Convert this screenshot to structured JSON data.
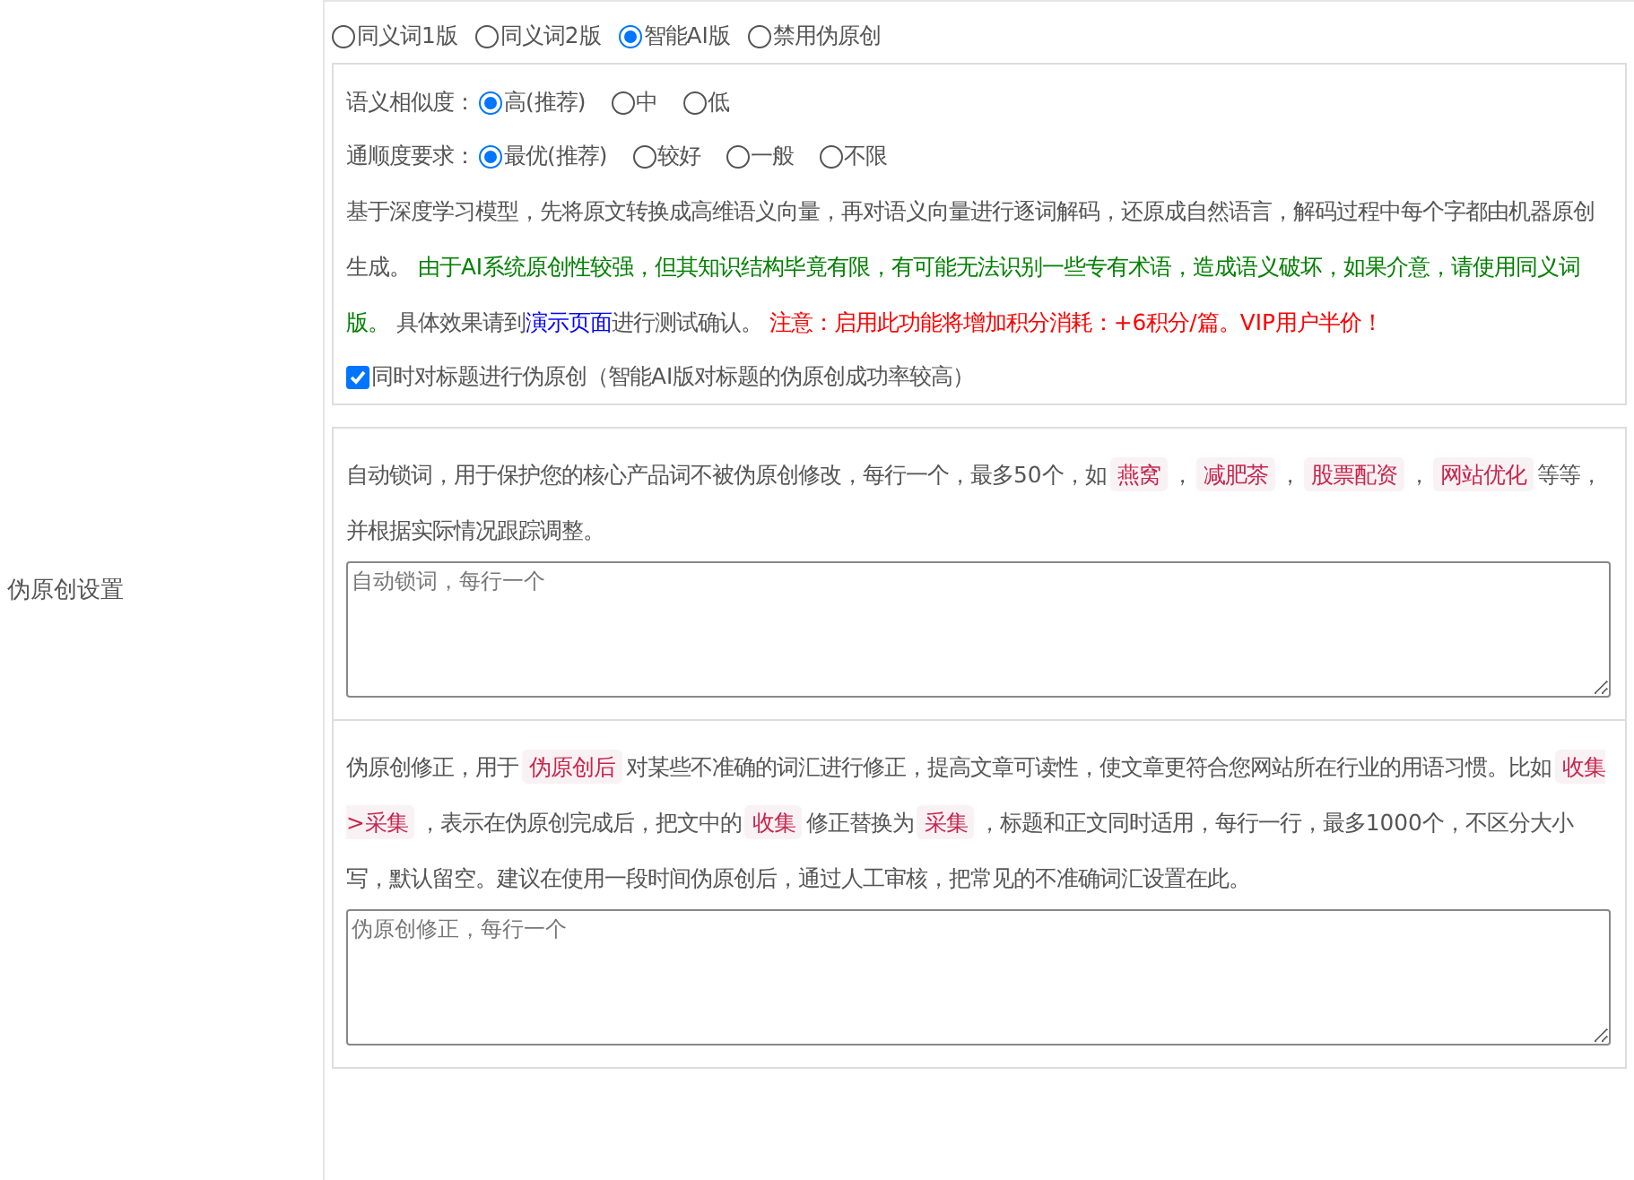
{
  "sidebar": {
    "label": "伪原创设置"
  },
  "modes": [
    {
      "label": "同义词1版",
      "selected": false
    },
    {
      "label": "同义词2版",
      "selected": false
    },
    {
      "label": "智能AI版",
      "selected": true
    },
    {
      "label": "禁用伪原创",
      "selected": false
    }
  ],
  "ai_panel": {
    "similarity": {
      "label": "语义相似度：",
      "options": [
        {
          "label": "高(推荐)",
          "selected": true
        },
        {
          "label": "中",
          "selected": false
        },
        {
          "label": "低",
          "selected": false
        }
      ]
    },
    "fluency": {
      "label": "通顺度要求：",
      "options": [
        {
          "label": "最优(推荐)",
          "selected": true
        },
        {
          "label": "较好",
          "selected": false
        },
        {
          "label": "一般",
          "selected": false
        },
        {
          "label": "不限",
          "selected": false
        }
      ]
    },
    "description": [
      {
        "kind": "plain",
        "text": "基于深度学习模型，先将原文转换成高维语义向量，再对语义向量进行逐词解码，还原成自然语言，解码过程中每个字都由机器原创生成。 "
      },
      {
        "kind": "green",
        "text": "由于AI系统原创性较强，但其知识结构毕竟有限，有可能无法识别一些专有术语，造成语义破坏，如果介意，请使用同义词版。"
      },
      {
        "kind": "plain",
        "text": " 具体效果请到"
      },
      {
        "kind": "link",
        "text": "演示页面"
      },
      {
        "kind": "plain",
        "text": "进行测试确认。 "
      },
      {
        "kind": "red",
        "text": "注意：启用此功能将增加积分消耗：+6积分/篇。VIP用户半价！"
      }
    ],
    "title_option": {
      "label": "同时对标题进行伪原创（智能AI版对标题的伪原创成功率较高）",
      "checked": true
    }
  },
  "lock_words": {
    "description": [
      {
        "kind": "plain",
        "text": "自动锁词，用于保护您的核心产品词不被伪原创修改，每行一个，最多50个，如"
      },
      {
        "kind": "tag",
        "text": "燕窝"
      },
      {
        "kind": "plain",
        "text": "，"
      },
      {
        "kind": "tag",
        "text": "减肥茶"
      },
      {
        "kind": "plain",
        "text": "，"
      },
      {
        "kind": "tag",
        "text": "股票配资"
      },
      {
        "kind": "plain",
        "text": "，"
      },
      {
        "kind": "tag",
        "text": "网站优化"
      },
      {
        "kind": "plain",
        "text": "等等，并根据实际情况跟踪调整。"
      }
    ],
    "placeholder": "自动锁词，每行一个"
  },
  "corrections": {
    "description": [
      {
        "kind": "plain",
        "text": "伪原创修正，用于"
      },
      {
        "kind": "tag",
        "text": "伪原创后"
      },
      {
        "kind": "plain",
        "text": "对某些不准确的词汇进行修正，提高文章可读性，使文章更符合您网站所在行业的用语习惯。比如"
      },
      {
        "kind": "tag",
        "text": "收集>采集"
      },
      {
        "kind": "plain",
        "text": "，表示在伪原创完成后，把文中的"
      },
      {
        "kind": "tag",
        "text": "收集"
      },
      {
        "kind": "plain",
        "text": "修正替换为"
      },
      {
        "kind": "tag",
        "text": "采集"
      },
      {
        "kind": "plain",
        "text": "，标题和正文同时适用，每行一行，最多1000个，不区分大小写，默认留空。建议在使用一段时间伪原创后，通过人工审核，把常见的不准确词汇设置在此。"
      }
    ],
    "placeholder": "伪原创修正，每行一个"
  }
}
